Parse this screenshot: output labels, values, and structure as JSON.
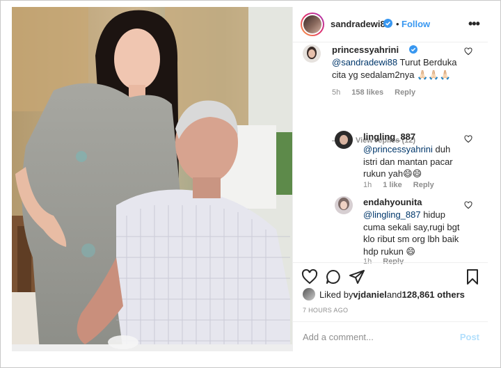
{
  "post": {
    "username": "sandradewi88",
    "follow_label": "Follow",
    "dot": "•"
  },
  "comments": [
    {
      "username": "princessyahrini",
      "mention": "@sandradewi88",
      "text_line1": " Turut Berduka",
      "text_line2": "cita yg sedalam2nya 🙏🏻🙏🏻🙏🏻",
      "age": "5h",
      "likes": "158 likes",
      "reply_label": "Reply",
      "view_replies": "View replies (12)"
    },
    {
      "username": "lingling_887",
      "mention": "@princessyahrini",
      "text_after": " duh",
      "text_line2": "istri dan mantan pacar",
      "text_line3": "rukun yah😄😄",
      "age": "1h",
      "likes": "1 like",
      "reply_label": "Reply"
    },
    {
      "username": "endahyounita",
      "mention": "@lingling_887",
      "text_after": " hidup",
      "text_line2": "cuma sekali say,rugi bgt",
      "text_line3": "klo ribut sm org lbh baik",
      "text_line4": "hdp rukun 😄",
      "age": "1h",
      "reply_label": "Reply"
    }
  ],
  "likes_summary": {
    "prefix": "Liked by ",
    "user": "vjdaniel",
    "middle": " and ",
    "count": "128,861 others"
  },
  "timestamp": "7 HOURS AGO",
  "add_comment": {
    "placeholder": "Add a comment...",
    "post_label": "Post"
  },
  "icons": [
    "verified-icon",
    "more-icon",
    "heart-icon",
    "comment-icon",
    "share-icon",
    "bookmark-icon"
  ],
  "colors": {
    "link": "#3897f0",
    "mention": "#00376b",
    "muted": "#8e8e8e",
    "post_disabled": "#b2dffc"
  }
}
